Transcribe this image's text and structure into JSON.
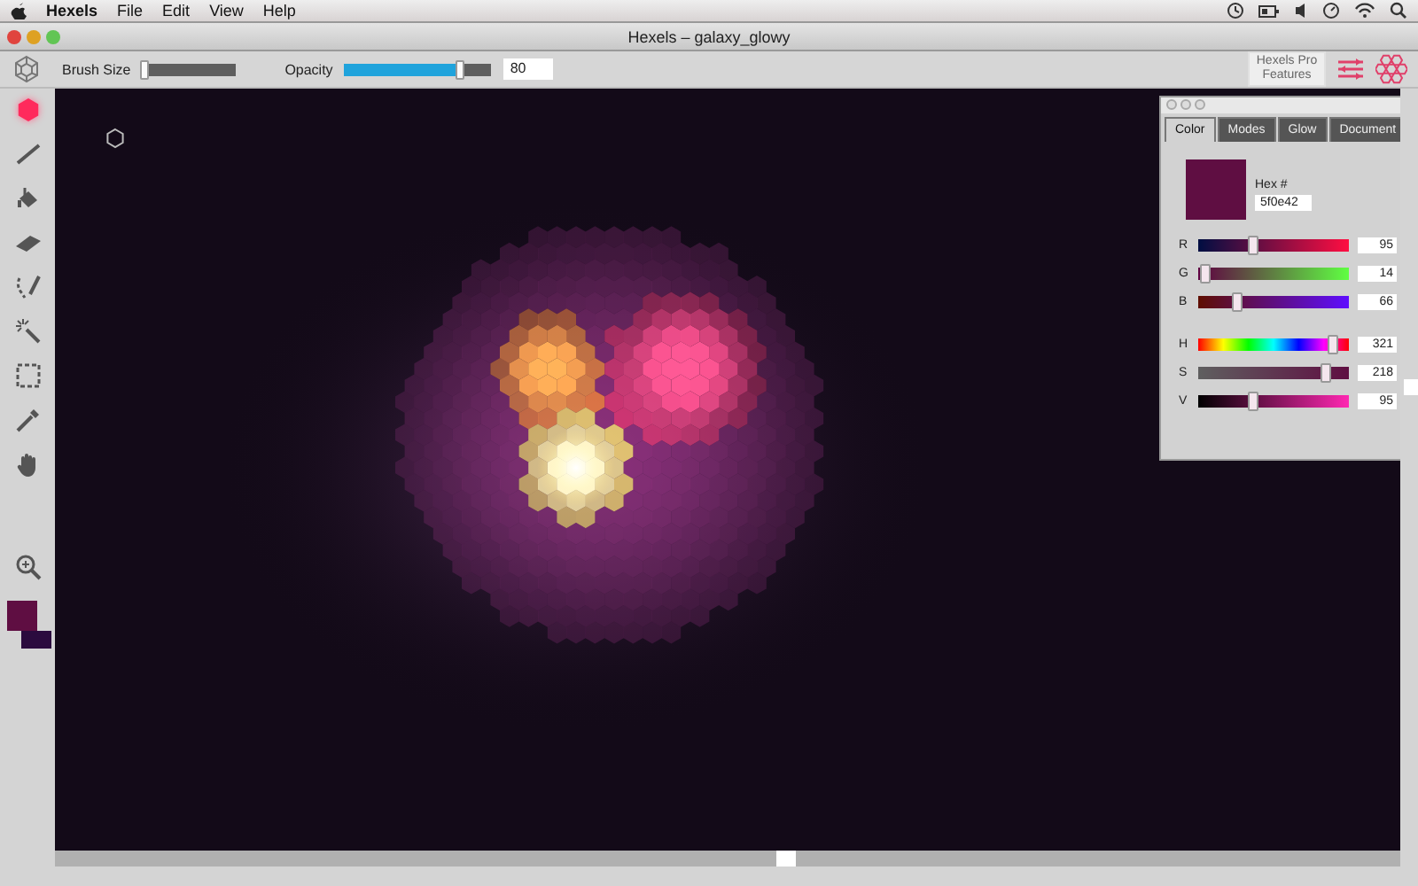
{
  "menu_bar": {
    "app": "Hexels",
    "items": [
      "File",
      "Edit",
      "View",
      "Help"
    ]
  },
  "window": {
    "title": "Hexels – galaxy_glowy"
  },
  "toolbar": {
    "brush_size": {
      "label": "Brush Size",
      "level": 0.05
    },
    "opacity": {
      "label": "Opacity",
      "level": 0.8,
      "value": "80"
    },
    "pro_button": "Hexels Pro Features"
  },
  "tools": [
    {
      "kind": "hex",
      "selected": true
    },
    {
      "kind": "line",
      "selected": false
    },
    {
      "kind": "bucket",
      "selected": false
    },
    {
      "kind": "eraser",
      "selected": false
    },
    {
      "kind": "lasso",
      "selected": false
    },
    {
      "kind": "wand",
      "selected": false
    },
    {
      "kind": "marquee",
      "selected": false
    },
    {
      "kind": "dropper",
      "selected": false
    },
    {
      "kind": "hand",
      "selected": false
    },
    {
      "kind": "zoom",
      "selected": false
    }
  ],
  "swatches": [
    {
      "color": "#5f0e42"
    },
    {
      "color": "#2b0b3e"
    }
  ],
  "color_panel": {
    "tabs": [
      {
        "label": "Color",
        "selected": true
      },
      {
        "label": "Modes",
        "selected": false
      },
      {
        "label": "Glow",
        "selected": false
      },
      {
        "label": "Document",
        "selected": false
      }
    ],
    "hex_label": "Hex #",
    "hex_value": "5f0e42",
    "channels": [
      {
        "kind": "r",
        "label": "R",
        "level": 0.37,
        "value": "95"
      },
      {
        "kind": "g",
        "label": "G",
        "level": 0.05,
        "value": "14"
      },
      {
        "kind": "b",
        "label": "B",
        "level": 0.26,
        "value": "66"
      },
      {
        "kind": "h",
        "label": "H",
        "level": 0.89,
        "value": "321"
      },
      {
        "kind": "s",
        "label": "S",
        "level": 0.85,
        "value": "218"
      },
      {
        "kind": "v",
        "label": "V",
        "level": 0.37,
        "value": "95"
      }
    ]
  }
}
